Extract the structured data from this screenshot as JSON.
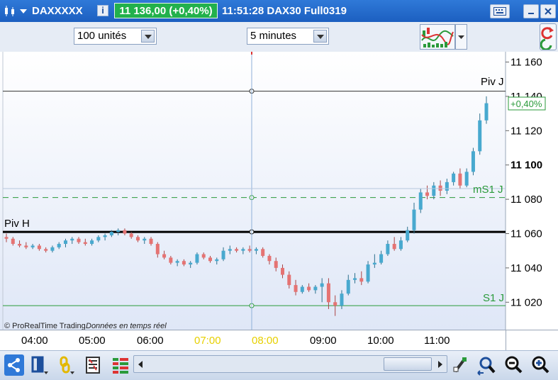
{
  "titlebar": {
    "symbol": "DAXXXXX",
    "price_badge": "11 136,00 (+0,40%)",
    "time_label": "11:51:28 DAX30 Full0319"
  },
  "toolbar": {
    "units_value": "100 unités",
    "period_value": "5 minutes"
  },
  "chart": {
    "copyright": "© ProRealTime Trading",
    "realtime_note": "Données en temps réel",
    "last_change": "+0,40%",
    "levels": {
      "piv_j": "Piv J",
      "piv_h": "Piv H",
      "ms1_j": "mS1 J",
      "s1_j": "S1 J"
    },
    "y_ticks": [
      "11 160",
      "11 140",
      "11 120",
      "11 100",
      "11 080",
      "11 060",
      "11 040",
      "11 020"
    ],
    "x_ticks": [
      "04:00",
      "05:00",
      "06:00",
      "07:00",
      "08:00",
      "09:00",
      "10:00",
      "11:00"
    ],
    "colors": {
      "up": "#48a9cf",
      "down": "#e57373",
      "green": "#2a9a3a"
    }
  },
  "chart_data": {
    "type": "candlestick",
    "title": "DAX30 Full0319",
    "timeframe": "5 minutes",
    "ylim": [
      11004,
      11166
    ],
    "y_ticks": [
      11160,
      11140,
      11120,
      11100,
      11080,
      11060,
      11040,
      11020
    ],
    "x_ticks": [
      "04:00",
      "05:00",
      "06:00",
      "07:00",
      "08:00",
      "09:00",
      "10:00",
      "11:00"
    ],
    "levels": [
      {
        "name": "Piv J",
        "value": 11143
      },
      {
        "name": "Piv H",
        "value": 11061
      },
      {
        "name": "mS1 J",
        "value": 11081
      },
      {
        "name": "S1 J",
        "value": 11018
      }
    ],
    "candles": [
      [
        11058,
        11060,
        11055,
        11057
      ],
      [
        11057,
        11058,
        11053,
        11054
      ],
      [
        11054,
        11056,
        11052,
        11053
      ],
      [
        11053,
        11055,
        11051,
        11052
      ],
      [
        11052,
        11054,
        11051,
        11053
      ],
      [
        11053,
        11054,
        11050,
        11051
      ],
      [
        11051,
        11052,
        11049,
        11050
      ],
      [
        11050,
        11053,
        11049,
        11052
      ],
      [
        11052,
        11055,
        11051,
        11054
      ],
      [
        11054,
        11057,
        11052,
        11056
      ],
      [
        11056,
        11058,
        11054,
        11057
      ],
      [
        11057,
        11058,
        11054,
        11055
      ],
      [
        11055,
        11057,
        11053,
        11054
      ],
      [
        11054,
        11057,
        11053,
        11056
      ],
      [
        11056,
        11059,
        11055,
        11058
      ],
      [
        11058,
        11060,
        11056,
        11059
      ],
      [
        11059,
        11062,
        11058,
        11061
      ],
      [
        11061,
        11063,
        11059,
        11062
      ],
      [
        11062,
        11063,
        11059,
        11060
      ],
      [
        11060,
        11061,
        11057,
        11058
      ],
      [
        11058,
        11059,
        11055,
        11056
      ],
      [
        11056,
        11058,
        11054,
        11057
      ],
      [
        11057,
        11058,
        11053,
        11054
      ],
      [
        11054,
        11055,
        11046,
        11048
      ],
      [
        11048,
        11050,
        11045,
        11046
      ],
      [
        11046,
        11047,
        11042,
        11043
      ],
      [
        11043,
        11045,
        11041,
        11044
      ],
      [
        11044,
        11045,
        11041,
        11042
      ],
      [
        11042,
        11044,
        11040,
        11043
      ],
      [
        11043,
        11049,
        11042,
        11048
      ],
      [
        11048,
        11049,
        11045,
        11046
      ],
      [
        11046,
        11047,
        11043,
        11044
      ],
      [
        11044,
        11046,
        11042,
        11045
      ],
      [
        11045,
        11052,
        11044,
        11050
      ],
      [
        11050,
        11053,
        11048,
        11051
      ],
      [
        11051,
        11052,
        11049,
        11050
      ],
      [
        11050,
        11052,
        11048,
        11051
      ],
      [
        11051,
        11053,
        11049,
        11050
      ],
      [
        11050,
        11052,
        11048,
        11051
      ],
      [
        11051,
        11052,
        11046,
        11047
      ],
      [
        11047,
        11048,
        11042,
        11044
      ],
      [
        11044,
        11046,
        11038,
        11040
      ],
      [
        11040,
        11042,
        11034,
        11036
      ],
      [
        11036,
        11038,
        11028,
        11030
      ],
      [
        11030,
        11033,
        11024,
        11026
      ],
      [
        11026,
        11030,
        11025,
        11029
      ],
      [
        11029,
        11031,
        11026,
        11027
      ],
      [
        11027,
        11030,
        11025,
        11029
      ],
      [
        11029,
        11034,
        11020,
        11031
      ],
      [
        11031,
        11034,
        11016,
        11020
      ],
      [
        11020,
        11024,
        11012,
        11018
      ],
      [
        11018,
        11027,
        11016,
        11025
      ],
      [
        11025,
        11036,
        11024,
        11033
      ],
      [
        11033,
        11037,
        11031,
        11034
      ],
      [
        11034,
        11038,
        11030,
        11032
      ],
      [
        11032,
        11044,
        11031,
        11042
      ],
      [
        11042,
        11048,
        11040,
        11043
      ],
      [
        11043,
        11050,
        11042,
        11048
      ],
      [
        11048,
        11056,
        11047,
        11054
      ],
      [
        11054,
        11058,
        11050,
        11051
      ],
      [
        11051,
        11058,
        11050,
        11056
      ],
      [
        11056,
        11064,
        11055,
        11062
      ],
      [
        11062,
        11078,
        11060,
        11074
      ],
      [
        11074,
        11086,
        11072,
        11084
      ],
      [
        11084,
        11088,
        11080,
        11082
      ],
      [
        11082,
        11090,
        11080,
        11088
      ],
      [
        11088,
        11091,
        11082,
        11085
      ],
      [
        11085,
        11092,
        11083,
        11090
      ],
      [
        11090,
        11096,
        11088,
        11095
      ],
      [
        11095,
        11098,
        11086,
        11088
      ],
      [
        11088,
        11098,
        11087,
        11096
      ],
      [
        11096,
        11110,
        11094,
        11108
      ],
      [
        11108,
        11130,
        11106,
        11126
      ],
      [
        11126,
        11140,
        11124,
        11136
      ]
    ]
  }
}
